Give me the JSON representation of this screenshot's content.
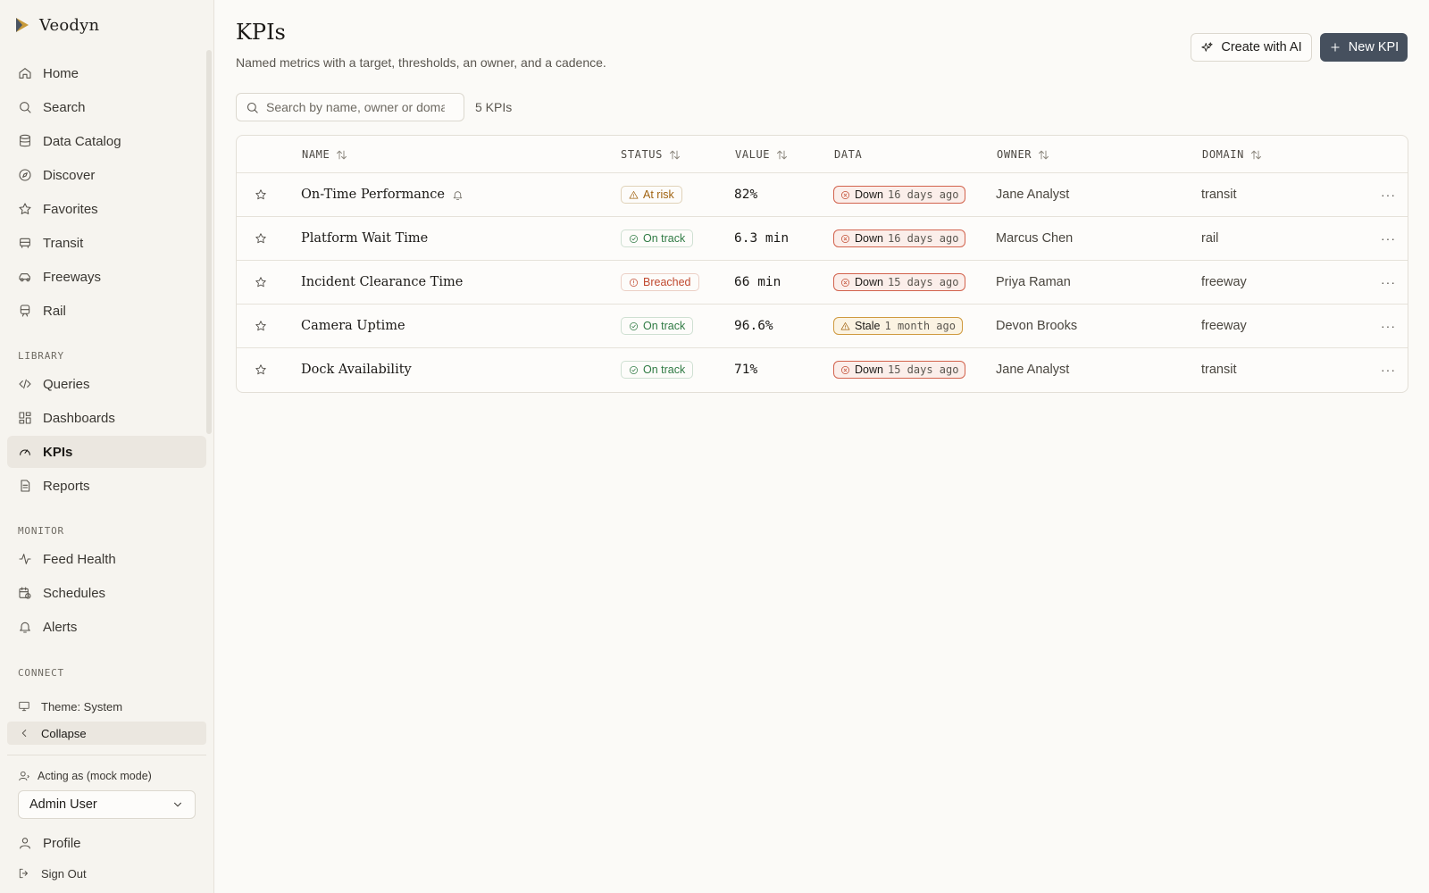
{
  "app": {
    "name": "Veodyn",
    "accent": "#46505e"
  },
  "sidebar": {
    "nav": [
      {
        "label": "Home",
        "icon": "home-icon"
      },
      {
        "label": "Search",
        "icon": "search-icon"
      },
      {
        "label": "Data Catalog",
        "icon": "database-icon"
      },
      {
        "label": "Discover",
        "icon": "compass-icon"
      },
      {
        "label": "Favorites",
        "icon": "star-icon"
      },
      {
        "label": "Transit",
        "icon": "bus-icon"
      },
      {
        "label": "Freeways",
        "icon": "car-icon"
      },
      {
        "label": "Rail",
        "icon": "train-icon"
      }
    ],
    "library_label": "LIBRARY",
    "library": [
      {
        "label": "Queries",
        "icon": "code-icon"
      },
      {
        "label": "Dashboards",
        "icon": "dashboard-icon"
      },
      {
        "label": "KPIs",
        "icon": "gauge-icon",
        "active": true
      },
      {
        "label": "Reports",
        "icon": "report-icon"
      }
    ],
    "monitor_label": "MONITOR",
    "monitor": [
      {
        "label": "Feed Health",
        "icon": "activity-icon"
      },
      {
        "label": "Schedules",
        "icon": "calendar-clock-icon"
      },
      {
        "label": "Alerts",
        "icon": "bell-icon"
      }
    ],
    "connect_label": "CONNECT",
    "theme_label": "Theme: System",
    "collapse_label": "Collapse",
    "acting_label": "Acting as (mock mode)",
    "acting_user": "Admin User",
    "profile_label": "Profile",
    "signout_label": "Sign Out"
  },
  "header": {
    "title": "KPIs",
    "subtitle": "Named metrics with a target, thresholds, an owner, and a cadence.",
    "create_ai_label": "Create with AI",
    "new_kpi_label": "New KPI"
  },
  "search": {
    "placeholder": "Search by name, owner or domain",
    "value": ""
  },
  "count_label": "5 KPIs",
  "table": {
    "columns": {
      "name": "NAME",
      "status": "STATUS",
      "value": "VALUE",
      "data": "DATA",
      "owner": "OWNER",
      "domain": "DOMAIN"
    },
    "rows": [
      {
        "name": "On-Time Performance",
        "alert": true,
        "status": "At risk",
        "status_kind": "at-risk",
        "value": "82%",
        "data_state": "Down",
        "data_kind": "down",
        "data_age": "16 days ago",
        "owner": "Jane Analyst",
        "domain": "transit"
      },
      {
        "name": "Platform Wait Time",
        "alert": false,
        "status": "On track",
        "status_kind": "on-track",
        "value": "6.3 min",
        "data_state": "Down",
        "data_kind": "down",
        "data_age": "16 days ago",
        "owner": "Marcus Chen",
        "domain": "rail"
      },
      {
        "name": "Incident Clearance Time",
        "alert": false,
        "status": "Breached",
        "status_kind": "breached",
        "value": "66 min",
        "data_state": "Down",
        "data_kind": "down",
        "data_age": "15 days ago",
        "owner": "Priya Raman",
        "domain": "freeway"
      },
      {
        "name": "Camera Uptime",
        "alert": false,
        "status": "On track",
        "status_kind": "on-track",
        "value": "96.6%",
        "data_state": "Stale",
        "data_kind": "stale",
        "data_age": "1 month ago",
        "owner": "Devon Brooks",
        "domain": "freeway"
      },
      {
        "name": "Dock Availability",
        "alert": false,
        "status": "On track",
        "status_kind": "on-track",
        "value": "71%",
        "data_state": "Down",
        "data_kind": "down",
        "data_age": "15 days ago",
        "owner": "Jane Analyst",
        "domain": "transit"
      }
    ]
  },
  "colors": {
    "at_risk": "#a0620f",
    "on_track": "#2f7a43",
    "breached": "#c0492f",
    "down_border": "#d2634d",
    "stale_border": "#cf9a3f"
  }
}
